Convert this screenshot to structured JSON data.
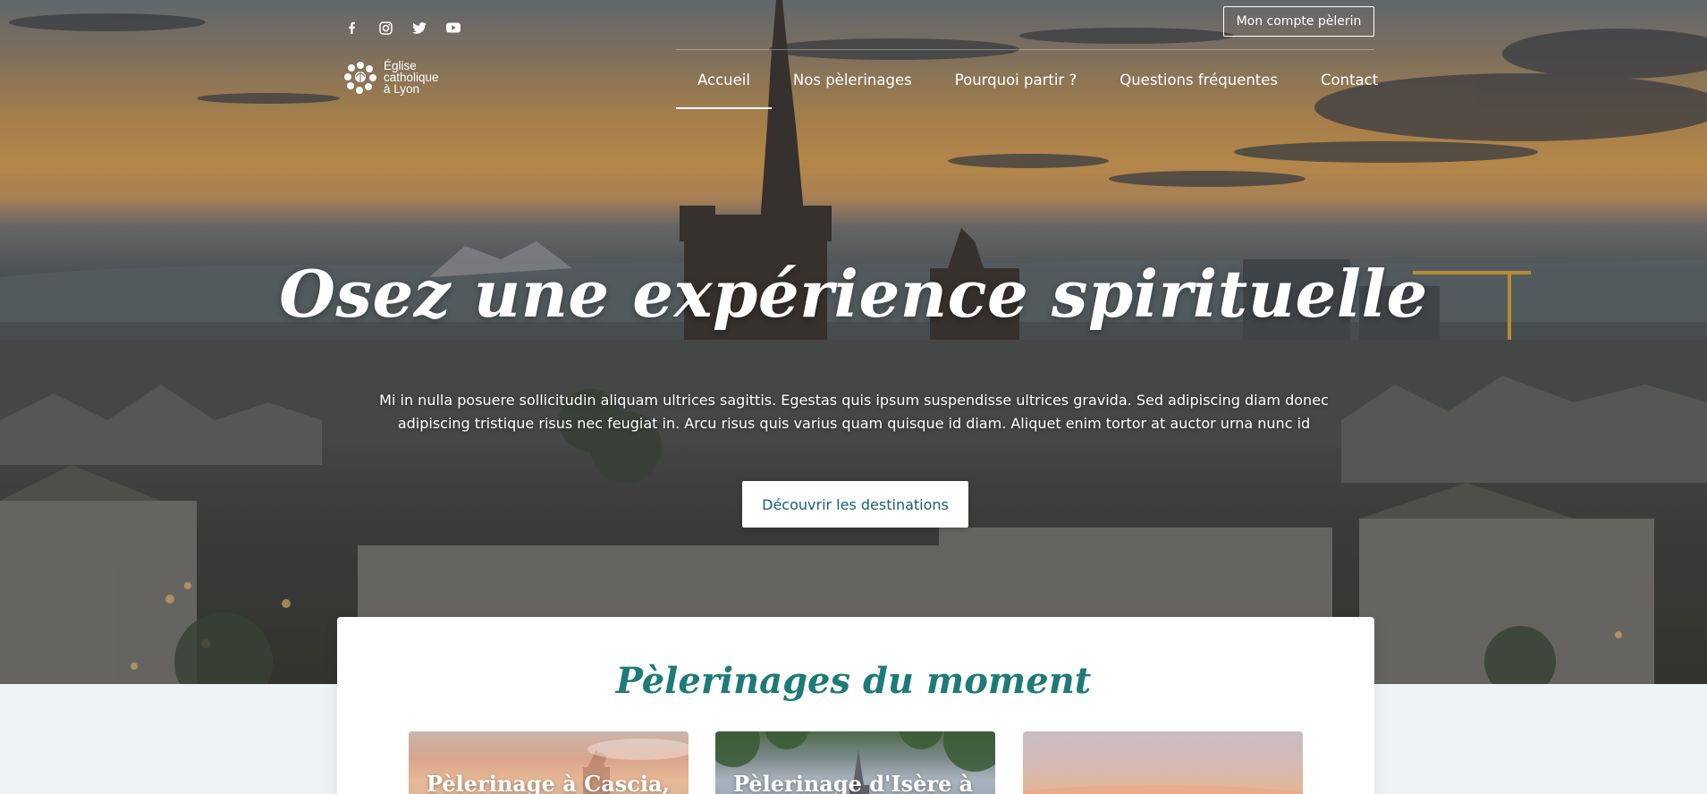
{
  "social": {
    "icons": [
      "facebook-icon",
      "instagram-icon",
      "twitter-icon",
      "youtube-icon"
    ]
  },
  "account_button": "Mon compte pèlerin",
  "logo": {
    "line1": "Église",
    "line2": "catholique",
    "line3": "à Lyon"
  },
  "nav": {
    "items": [
      {
        "label": "Accueil",
        "active": true
      },
      {
        "label": "Nos pèlerinages",
        "active": false
      },
      {
        "label": "Pourquoi partir ?",
        "active": false
      },
      {
        "label": "Questions fréquentes",
        "active": false
      },
      {
        "label": "Contact",
        "active": false
      }
    ]
  },
  "hero": {
    "title": "Osez une expérience spirituelle",
    "text": "Mi in nulla posuere sollicitudin aliquam ultrices sagittis. Egestas quis ipsum suspendisse ultrices gravida. Sed adipiscing diam donec adipiscing tristique risus nec feugiat in. Arcu risus quis varius quam quisque id diam. Aliquet enim tortor at auctor urna nunc id",
    "cta": "Découvrir les destinations"
  },
  "section": {
    "title": "Pèlerinages du moment",
    "cards": [
      {
        "title": "Pèlerinage à Cascia,"
      },
      {
        "title": "Pèlerinage d'Isère à"
      },
      {
        "title": ""
      }
    ]
  },
  "colors": {
    "accent": "#1d7a78",
    "cta_text": "#17606c",
    "page_background": "#eef3f5"
  }
}
